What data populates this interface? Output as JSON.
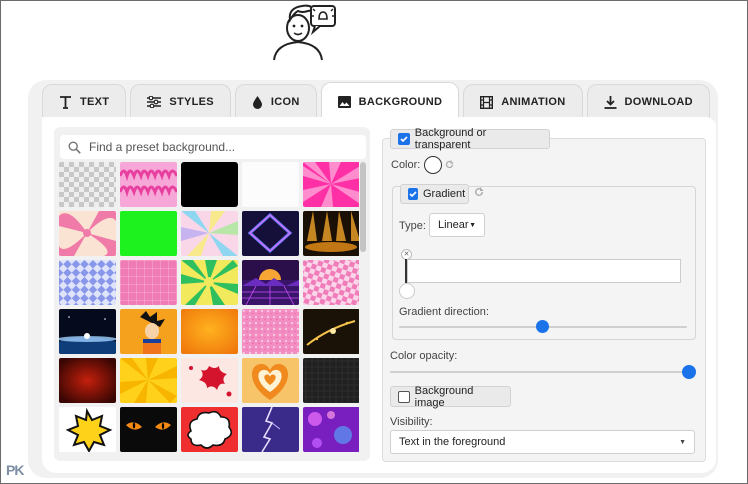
{
  "tabs": [
    {
      "label": "TEXT",
      "icon": "text-t-icon"
    },
    {
      "label": "STYLES",
      "icon": "sliders-icon"
    },
    {
      "label": "ICON",
      "icon": "drop-icon"
    },
    {
      "label": "BACKGROUND",
      "icon": "image-icon"
    },
    {
      "label": "ANIMATION",
      "icon": "film-icon"
    },
    {
      "label": "DOWNLOAD",
      "icon": "download-icon"
    }
  ],
  "active_tab": "BACKGROUND",
  "search": {
    "placeholder": "Find a preset background..."
  },
  "presets": [
    "transparent-checker",
    "pink-flames",
    "black",
    "white",
    "pink-rays",
    "pink-swirl",
    "green",
    "pastel-rays",
    "neon-diamond",
    "stage-lights",
    "blue-checker",
    "pink-grid",
    "green-rays",
    "retro-sunset",
    "pink-checker-warp",
    "space-earth",
    "anime-character",
    "orange-gradient",
    "pink-glitter",
    "gold-sparkle",
    "red-halftone",
    "yellow-rays",
    "red-splat",
    "orange-hearts",
    "dark-pattern",
    "comic-burst",
    "cat-eyes",
    "comic-cloud",
    "lightning",
    "purple-bokeh"
  ],
  "settings": {
    "bg_or_transparent_label": "Background or transparent",
    "bg_or_transparent_checked": true,
    "color_label": "Color:",
    "gradient_label": "Gradient",
    "gradient_checked": true,
    "type_label": "Type:",
    "type_value": "Linear",
    "gradient_direction_label": "Gradient direction:",
    "gradient_direction_value": 0.5,
    "color_opacity_label": "Color opacity:",
    "color_opacity_value": 1.0,
    "bg_image_label": "Background image",
    "bg_image_checked": false,
    "visibility_label": "Visibility:",
    "visibility_value": "Text in the foreground"
  },
  "colors": {
    "accent": "#1a73e8"
  },
  "watermark": "PK"
}
